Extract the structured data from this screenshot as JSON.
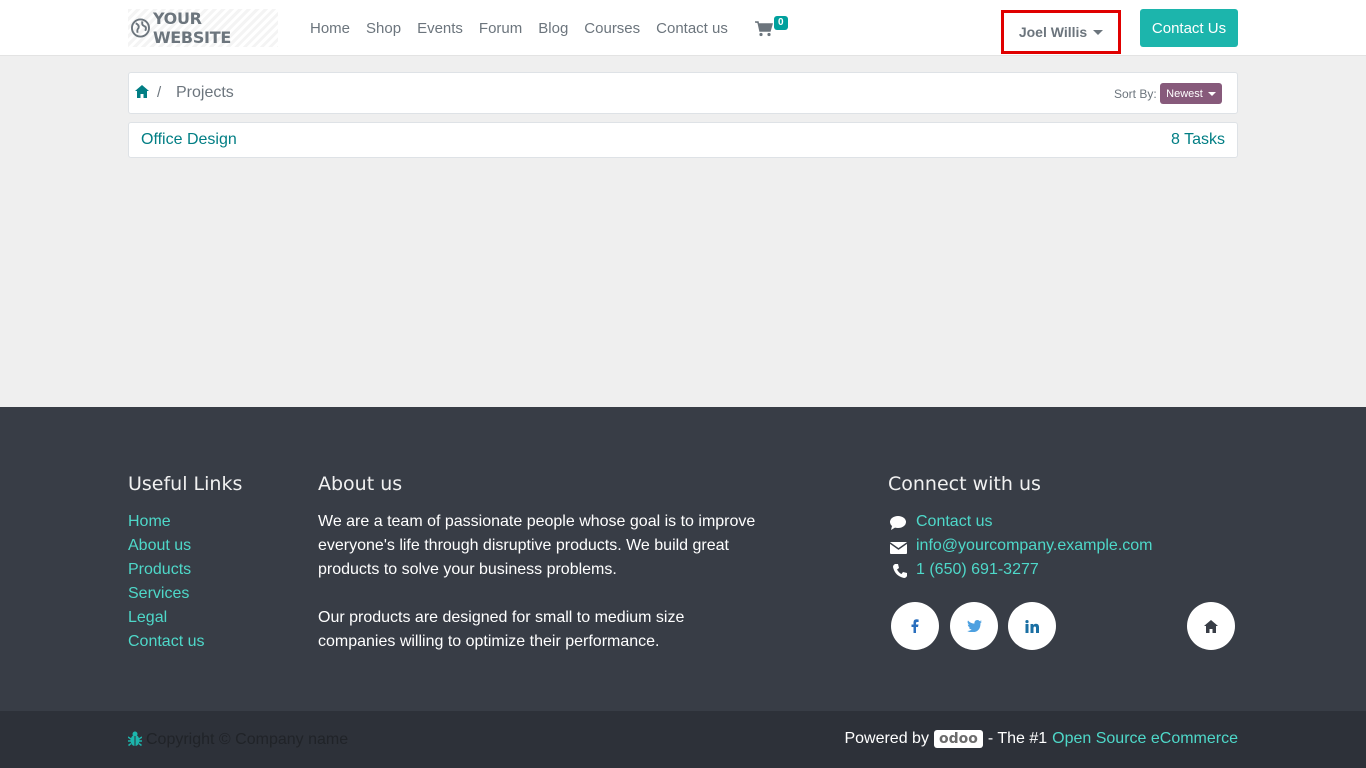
{
  "header": {
    "logo_text": "YOUR WEBSITE",
    "nav": [
      "Home",
      "Shop",
      "Events",
      "Forum",
      "Blog",
      "Courses",
      "Contact us"
    ],
    "cart_count": "0",
    "user_name": "Joel Willis",
    "contact_button": "Contact Us"
  },
  "breadcrumb": {
    "current": "Projects",
    "separator": "/",
    "sort_label": "Sort By:",
    "sort_value": "Newest"
  },
  "projects": [
    {
      "name": "Office Design",
      "tasks": "8 Tasks"
    }
  ],
  "footer": {
    "useful_links_heading": "Useful Links",
    "useful_links": [
      "Home",
      "About us",
      "Products",
      "Services",
      "Legal",
      "Contact us"
    ],
    "about_heading": "About us",
    "about_lines_1": [
      "We are a team of passionate people whose goal is to improve",
      "everyone's life through disruptive products. We build great",
      "products to solve your business problems."
    ],
    "about_lines_2": [
      "Our products are designed for small to medium size",
      "companies willing to optimize their performance."
    ],
    "connect_heading": "Connect with us",
    "contact_link": "Contact us",
    "email": "info@yourcompany.example.com",
    "phone": "1 (650) 691-3277",
    "social_icons": [
      "facebook-icon",
      "twitter-icon",
      "linkedin-icon",
      "home-icon"
    ]
  },
  "bottom": {
    "copyright": "Copyright © Company name",
    "powered_by": "Powered by",
    "odoo": "odoo",
    "tagline": "- The #1",
    "tagline_link": "Open Source eCommerce"
  },
  "colors": {
    "accent": "#1cb5ac",
    "link": "#017e84",
    "footer_bg": "#383d46",
    "footer_link": "#4ed8c9",
    "sort_button": "#875a7b",
    "highlight_box": "#e00000"
  }
}
